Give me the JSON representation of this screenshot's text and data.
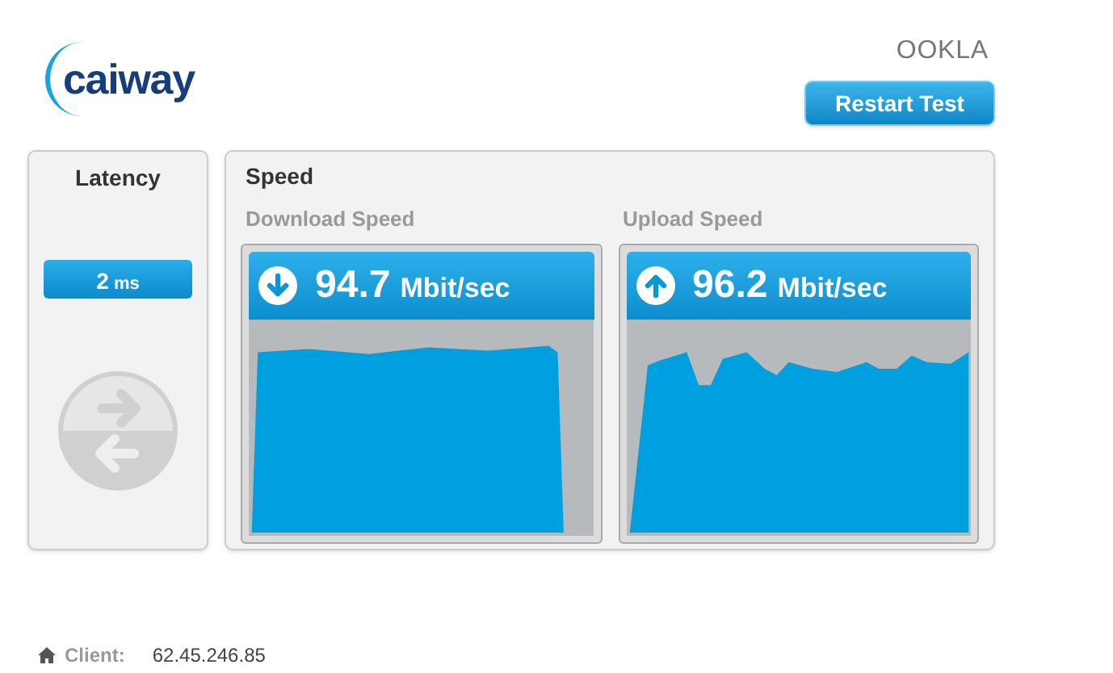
{
  "brand": {
    "logo": "caiway",
    "partner_logo": "OOKLA"
  },
  "restart_button": "Restart Test",
  "latency": {
    "title": "Latency",
    "value": "2",
    "unit": "ms"
  },
  "speed": {
    "title": "Speed",
    "meters": [
      {
        "kind": "download",
        "label": "Download Speed",
        "value": "94.7",
        "unit": "Mbit/sec"
      },
      {
        "kind": "upload",
        "label": "Upload Speed",
        "value": "96.2",
        "unit": "Mbit/sec"
      }
    ]
  },
  "footer": {
    "label": "Client:",
    "value": "62.45.246.85"
  }
}
